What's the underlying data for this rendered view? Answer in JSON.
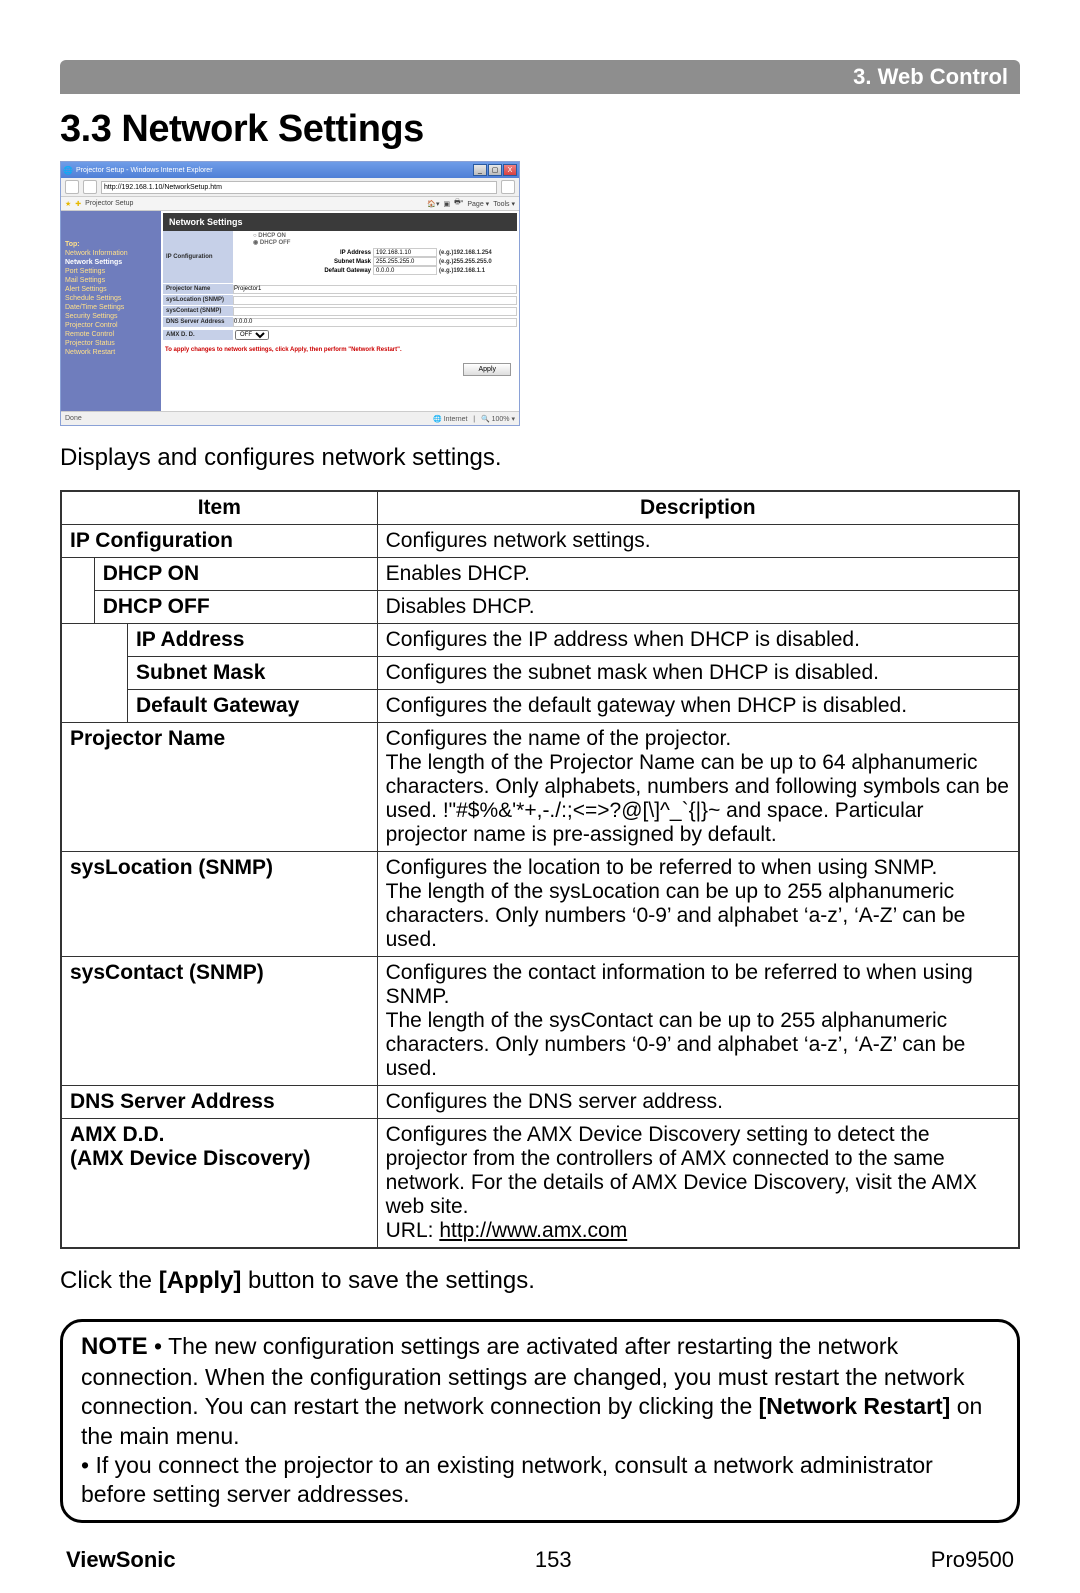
{
  "header": {
    "breadcrumb": "3. Web Control"
  },
  "section": {
    "number": "3.3",
    "title": "Network Settings",
    "intro": "Displays and configures network settings."
  },
  "screenshot": {
    "window_title": "Projector Setup - Windows Internet Explorer",
    "close": "X",
    "url": "http://192.168.1.10/NetworkSetup.htm",
    "tab": "Projector Setup",
    "page_dropdown": "Page ▾",
    "tools_dropdown": "Tools ▾",
    "panel_title": "Network Settings",
    "sidebar": {
      "top": "Top:",
      "items": [
        "Network Information",
        "Network Settings",
        "Port Settings",
        "Mail Settings",
        "Alert Settings",
        "Schedule Settings",
        "Date/Time Settings",
        "Security Settings",
        "Projector Control",
        "Remote Control",
        "Projector Status",
        "Network Restart"
      ]
    },
    "form": {
      "ip_configuration_label": "IP Configuration",
      "dhcp_on": "DHCP ON",
      "dhcp_off": "DHCP OFF",
      "ip_address_label": "IP Address",
      "ip_address_value": "192.168.1.10",
      "ip_address_hint": "(e.g.)192.168.1.254",
      "subnet_mask_label": "Subnet Mask",
      "subnet_mask_value": "255.255.255.0",
      "subnet_mask_hint": "(e.g.)255.255.255.0",
      "default_gateway_label": "Default Gateway",
      "default_gateway_value": "0.0.0.0",
      "default_gateway_hint": "(e.g.)192.168.1.1",
      "projector_name_label": "Projector Name",
      "projector_name_value": "Projector1",
      "syslocation_label": "sysLocation (SNMP)",
      "syscontact_label": "sysContact (SNMP)",
      "dns_label": "DNS Server Address",
      "dns_value": "0.0.0.0",
      "amx_label": "AMX D. D.",
      "amx_value": "OFF",
      "apply_note": "To apply changes to network settings, click Apply, then perform \"Network Restart\".",
      "apply_button": "Apply"
    },
    "status_internet": "Internet",
    "status_zoom": "100%"
  },
  "table": {
    "headers": {
      "item": "Item",
      "description": "Description"
    },
    "rows": [
      {
        "item": "IP Configuration",
        "desc": "Configures network settings.",
        "indent": 0,
        "bold": true
      },
      {
        "item": "DHCP ON",
        "desc": "Enables DHCP.",
        "indent": 1,
        "bold": true
      },
      {
        "item": "DHCP OFF",
        "desc": "Disables DHCP.",
        "indent": 1,
        "bold": true
      },
      {
        "item": "IP Address",
        "desc": "Configures the IP address when DHCP is disabled.",
        "indent": 2,
        "bold": true
      },
      {
        "item": "Subnet Mask",
        "desc": "Configures the subnet mask when DHCP is disabled.",
        "indent": 2,
        "bold": true
      },
      {
        "item": "Default Gateway",
        "desc": "Configures the default gateway when DHCP is disabled.",
        "indent": 2,
        "bold": true
      },
      {
        "item": "Projector Name",
        "desc": "Configures the name of the projector.\nThe length of the Projector Name can be up to 64 alphanumeric characters. Only alphabets, numbers and following symbols can be used.  !\"#$%&'*+,-./:;<=>?@[\\]^_`{|}~ and space. Particular projector name is pre-assigned by default.",
        "indent": 0,
        "bold": true
      },
      {
        "item": "sysLocation (SNMP)",
        "desc": "Configures the location to be referred to when using SNMP.\nThe length of the sysLocation can be up to 255 alphanumeric characters. Only numbers ‘0-9’ and alphabet ‘a-z’, ‘A-Z’ can be used.",
        "indent": 0,
        "bold": true
      },
      {
        "item": "sysContact (SNMP)",
        "desc": "Configures the contact information to be referred to when using SNMP.\nThe length of the sysContact can be up to 255 alphanumeric characters. Only numbers ‘0-9’ and alphabet ‘a-z’, ‘A-Z’ can be used.",
        "indent": 0,
        "bold": true
      },
      {
        "item": "DNS Server Address",
        "desc": "Configures the DNS  server address.",
        "indent": 0,
        "bold": true
      },
      {
        "item": "AMX D.D.\n(AMX Device Discovery)",
        "desc": "Configures the AMX Device Discovery setting to detect the projector from the controllers of AMX connected to the same network. For the details of AMX Device Discovery, visit the AMX web site.\nURL: http://www.amx.com",
        "indent": 0,
        "bold": true,
        "link": "http://www.amx.com"
      }
    ]
  },
  "apply_line": {
    "pre": "Click the ",
    "bold": "[Apply]",
    "post": " button to save the settings."
  },
  "note": {
    "label": "NOTE",
    "text1": " • The new configuration settings are activated after restarting the network connection. When the configuration settings are changed, you must restart the network connection. You can restart the network connection by clicking the ",
    "bold": "[Network Restart]",
    "text2": " on the main menu.",
    "text3": "• If you connect the projector to an existing network, consult a network administrator before setting server addresses."
  },
  "footer": {
    "brand": "ViewSonic",
    "page": "153",
    "model": "Pro9500"
  }
}
